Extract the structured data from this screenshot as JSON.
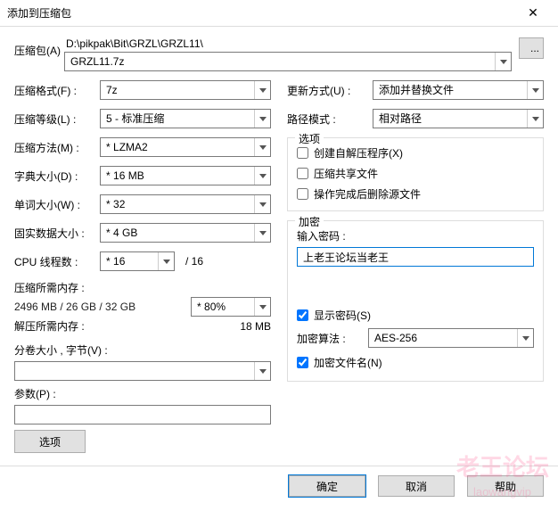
{
  "window": {
    "title": "添加到压缩包",
    "close": "✕"
  },
  "archive": {
    "label": "压缩包(A)",
    "path": "D:\\pikpak\\Bit\\GRZL\\GRZL11\\",
    "filename": "GRZL11.7z",
    "browse": "..."
  },
  "left": {
    "format": {
      "label": "压缩格式(F) :",
      "value": "7z"
    },
    "level": {
      "label": "压缩等级(L) :",
      "value": "5 - 标准压缩"
    },
    "method": {
      "label": "压缩方法(M) :",
      "value": "LZMA2",
      "aster": true
    },
    "dict": {
      "label": "字典大小(D) :",
      "value": "16 MB",
      "aster": true
    },
    "word": {
      "label": "单词大小(W) :",
      "value": "32",
      "aster": true
    },
    "solid": {
      "label": "固实数据大小 :",
      "value": "4 GB",
      "aster": true
    },
    "threads": {
      "label": "CPU 线程数 :",
      "value": "16",
      "aster": true,
      "suffix": "/ 16"
    },
    "memcomp": {
      "label": "压缩所需内存 :",
      "detail": "2496 MB / 26 GB / 32 GB",
      "pct": "80%",
      "aster": true
    },
    "memdecomp": {
      "label": "解压所需内存 :",
      "value": "18 MB"
    },
    "volume": {
      "label": "分卷大小 ,  字节(V) :"
    },
    "params": {
      "label": "参数(P) :"
    },
    "options_btn": "选项"
  },
  "right": {
    "update": {
      "label": "更新方式(U) :",
      "value": "添加并替换文件"
    },
    "pathmode": {
      "label": "路径模式 :",
      "value": "相对路径"
    },
    "opts": {
      "legend": "选项",
      "sfx": "创建自解压程序(X)",
      "shared": "压缩共享文件",
      "delete": "操作完成后删除源文件"
    },
    "enc": {
      "legend": "加密",
      "pass_label": "输入密码 :",
      "password": "上老王论坛当老王",
      "show": "显示密码(S)",
      "algo_label": "加密算法 :",
      "algo": "AES-256",
      "encnames": "加密文件名(N)"
    }
  },
  "footer": {
    "ok": "确定",
    "cancel": "取消",
    "help": "帮助"
  },
  "watermark": {
    "big": "老王论坛",
    "small": "laowangvip"
  }
}
